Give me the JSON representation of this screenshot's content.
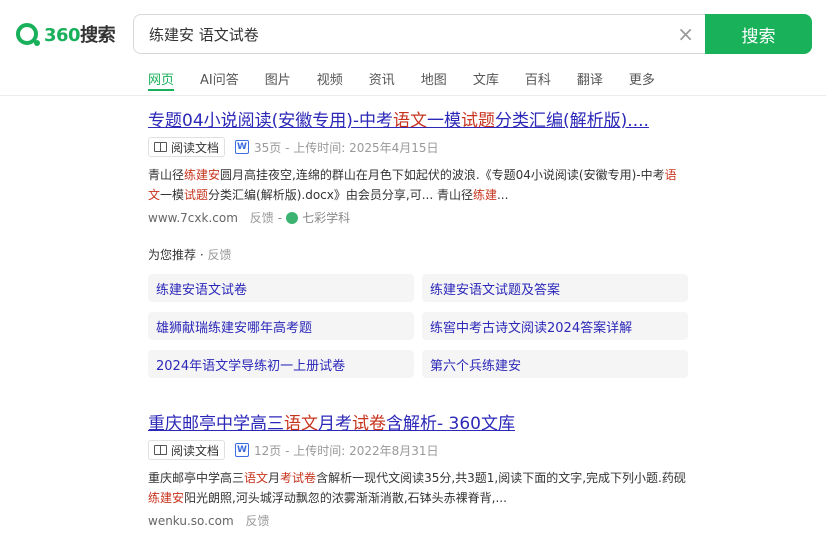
{
  "logo": {
    "num": "360",
    "text": "搜索"
  },
  "search": {
    "query": "练建安 语文试卷",
    "button": "搜索",
    "clear": "×"
  },
  "tabs": [
    "网页",
    "AI问答",
    "图片",
    "视频",
    "资讯",
    "地图",
    "文库",
    "百科",
    "翻译",
    "更多"
  ],
  "result1": {
    "title_parts": [
      "专题04小说阅读(安徽专用)-中考",
      "语文",
      "一模",
      "试题",
      "分类汇编(解析版)...."
    ],
    "tag": "阅读文档",
    "pages": "35页 - 上传时间: 2025年4月15日",
    "snippet_parts": [
      "青山径",
      "练建安",
      "圆月高挂夜空,连绵的群山在月色下如起伏的波浪.《专题04小说阅读(安徽专用)-中考",
      "语文",
      "一模",
      "试题",
      "分类汇编(解析版).docx》由会员分享,可... 青山径",
      "练建",
      "..."
    ],
    "url": "www.7cxk.com",
    "feedback": "反馈",
    "site": "七彩学科"
  },
  "recommend": {
    "title": "为您推荐",
    "feedback": "反馈",
    "items": [
      "练建安语文试卷",
      "练建安语文试题及答案",
      "雄狮献瑞练建安哪年高考题",
      "练窖中考古诗文阅读2024答案详解",
      "2024年语文学导练初一上册试卷",
      "第六个兵练建安"
    ]
  },
  "result2": {
    "title_parts": [
      "重庆邮亭中学高三",
      "语文",
      "月考",
      "试卷",
      "含解析- 360文库"
    ],
    "tag": "阅读文档",
    "pages": "12页 - 上传时间: 2022年8月31日",
    "snippet_parts": [
      "重庆邮亭中学高三",
      "语文",
      "月",
      "考试卷",
      "含解析一现代文阅读35分,共3题1,阅读下面的文字,完成下列小题.药砚",
      "练建安",
      "阳光朗照,河头城浮动飘忽的浓雾渐渐消散,石钵头赤裸脊背,..."
    ],
    "url": "wenku.so.com",
    "feedback": "反馈"
  },
  "colors": {
    "brand": "#19b25a",
    "link": "#2c28b8",
    "highlight": "#c7341e"
  }
}
